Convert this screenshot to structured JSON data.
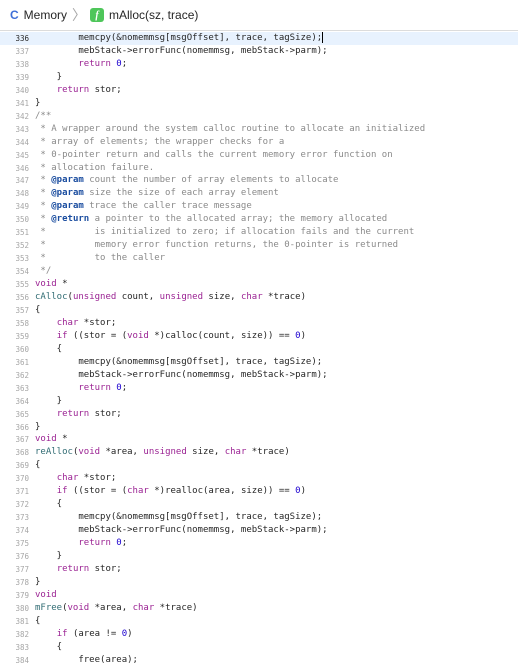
{
  "breadcrumb": {
    "file_icon": "C",
    "file_label": "Memory",
    "separator": "〉",
    "func_icon": "f",
    "func_label": "mAlloc(sz, trace)"
  },
  "colors": {
    "keyword": "#9b2393",
    "number": "#1c00cf",
    "comment": "#8a8a8a",
    "doc_tag": "#1c4ea0",
    "function_name": "#326d74",
    "current_line": "#e8f2fe"
  },
  "editor": {
    "current_line": 336,
    "lines": [
      {
        "n": "336",
        "current": true,
        "caret": true,
        "s": [
          [
            "t",
            "        memcpy(&nomemmsg[msgOffset], trace, tagSize);"
          ]
        ]
      },
      {
        "n": "337",
        "s": [
          [
            "t",
            "        mebStack->errorFunc(nomemmsg, mebStack->parm);"
          ]
        ]
      },
      {
        "n": "338",
        "s": [
          [
            "t",
            "        "
          ],
          [
            "k",
            "return"
          ],
          [
            "t",
            " "
          ],
          [
            "n",
            "0"
          ],
          [
            "t",
            ";"
          ]
        ]
      },
      {
        "n": "339",
        "s": [
          [
            "t",
            "    }"
          ]
        ]
      },
      {
        "n": "340",
        "s": [
          [
            "t",
            "    "
          ],
          [
            "k",
            "return"
          ],
          [
            "t",
            " stor;"
          ]
        ]
      },
      {
        "n": "341",
        "s": [
          [
            "t",
            "}"
          ]
        ]
      },
      {
        "n": "342",
        "s": [
          [
            "c",
            "/**"
          ]
        ]
      },
      {
        "n": "343",
        "s": [
          [
            "c",
            " * A wrapper around the system calloc routine to allocate an initialized"
          ]
        ]
      },
      {
        "n": "344",
        "s": [
          [
            "c",
            " * array of elements; the wrapper checks for a"
          ]
        ]
      },
      {
        "n": "345",
        "s": [
          [
            "c",
            " * 0-pointer return and calls the current memory error function on"
          ]
        ]
      },
      {
        "n": "346",
        "s": [
          [
            "c",
            " * allocation failure."
          ]
        ]
      },
      {
        "n": "347",
        "s": [
          [
            "c",
            " * "
          ],
          [
            "d",
            "@param"
          ],
          [
            "c",
            " count the number of array elements to allocate"
          ]
        ]
      },
      {
        "n": "348",
        "s": [
          [
            "c",
            " * "
          ],
          [
            "d",
            "@param"
          ],
          [
            "c",
            " size the size of each array element"
          ]
        ]
      },
      {
        "n": "349",
        "s": [
          [
            "c",
            " * "
          ],
          [
            "d",
            "@param"
          ],
          [
            "c",
            " trace the caller trace message"
          ]
        ]
      },
      {
        "n": "350",
        "s": [
          [
            "c",
            " * "
          ],
          [
            "d",
            "@return"
          ],
          [
            "c",
            " a pointer to the allocated array; the memory allocated"
          ]
        ]
      },
      {
        "n": "351",
        "s": [
          [
            "c",
            " *         is initialized to zero; if allocation fails and the current"
          ]
        ]
      },
      {
        "n": "352",
        "s": [
          [
            "c",
            " *         memory error function returns, the 0-pointer is returned"
          ]
        ]
      },
      {
        "n": "353",
        "s": [
          [
            "c",
            " *         to the caller"
          ]
        ]
      },
      {
        "n": "354",
        "s": [
          [
            "c",
            " */"
          ]
        ]
      },
      {
        "n": "355",
        "s": [
          [
            "k",
            "void"
          ],
          [
            "t",
            " *"
          ]
        ]
      },
      {
        "n": "356",
        "s": [
          [
            "f",
            "cAlloc"
          ],
          [
            "t",
            "("
          ],
          [
            "k",
            "unsigned"
          ],
          [
            "t",
            " count, "
          ],
          [
            "k",
            "unsigned"
          ],
          [
            "t",
            " size, "
          ],
          [
            "k",
            "char"
          ],
          [
            "t",
            " *trace)"
          ]
        ]
      },
      {
        "n": "357",
        "s": [
          [
            "t",
            "{"
          ]
        ]
      },
      {
        "n": "358",
        "s": [
          [
            "t",
            "    "
          ],
          [
            "k",
            "char"
          ],
          [
            "t",
            " *stor;"
          ]
        ]
      },
      {
        "n": "359",
        "s": [
          [
            "t",
            "    "
          ],
          [
            "k",
            "if"
          ],
          [
            "t",
            " ((stor = ("
          ],
          [
            "k",
            "void"
          ],
          [
            "t",
            " *)calloc(count, size)) == "
          ],
          [
            "n",
            "0"
          ],
          [
            "t",
            ")"
          ]
        ]
      },
      {
        "n": "360",
        "s": [
          [
            "t",
            "    {"
          ]
        ]
      },
      {
        "n": "361",
        "s": [
          [
            "t",
            "        memcpy(&nomemmsg[msgOffset], trace, tagSize);"
          ]
        ]
      },
      {
        "n": "362",
        "s": [
          [
            "t",
            "        mebStack->errorFunc(nomemmsg, mebStack->parm);"
          ]
        ]
      },
      {
        "n": "363",
        "s": [
          [
            "t",
            "        "
          ],
          [
            "k",
            "return"
          ],
          [
            "t",
            " "
          ],
          [
            "n",
            "0"
          ],
          [
            "t",
            ";"
          ]
        ]
      },
      {
        "n": "364",
        "s": [
          [
            "t",
            "    }"
          ]
        ]
      },
      {
        "n": "365",
        "s": [
          [
            "t",
            "    "
          ],
          [
            "k",
            "return"
          ],
          [
            "t",
            " stor;"
          ]
        ]
      },
      {
        "n": "366",
        "s": [
          [
            "t",
            "}"
          ]
        ]
      },
      {
        "n": "367",
        "s": [
          [
            "k",
            "void"
          ],
          [
            "t",
            " *"
          ]
        ]
      },
      {
        "n": "368",
        "s": [
          [
            "f",
            "reAlloc"
          ],
          [
            "t",
            "("
          ],
          [
            "k",
            "void"
          ],
          [
            "t",
            " *area, "
          ],
          [
            "k",
            "unsigned"
          ],
          [
            "t",
            " size, "
          ],
          [
            "k",
            "char"
          ],
          [
            "t",
            " *trace)"
          ]
        ]
      },
      {
        "n": "369",
        "s": [
          [
            "t",
            "{"
          ]
        ]
      },
      {
        "n": "370",
        "s": [
          [
            "t",
            "    "
          ],
          [
            "k",
            "char"
          ],
          [
            "t",
            " *stor;"
          ]
        ]
      },
      {
        "n": "371",
        "s": [
          [
            "t",
            "    "
          ],
          [
            "k",
            "if"
          ],
          [
            "t",
            " ((stor = ("
          ],
          [
            "k",
            "char"
          ],
          [
            "t",
            " *)realloc(area, size)) == "
          ],
          [
            "n",
            "0"
          ],
          [
            "t",
            ")"
          ]
        ]
      },
      {
        "n": "372",
        "s": [
          [
            "t",
            "    {"
          ]
        ]
      },
      {
        "n": "373",
        "s": [
          [
            "t",
            "        memcpy(&nomemmsg[msgOffset], trace, tagSize);"
          ]
        ]
      },
      {
        "n": "374",
        "s": [
          [
            "t",
            "        mebStack->errorFunc(nomemmsg, mebStack->parm);"
          ]
        ]
      },
      {
        "n": "375",
        "s": [
          [
            "t",
            "        "
          ],
          [
            "k",
            "return"
          ],
          [
            "t",
            " "
          ],
          [
            "n",
            "0"
          ],
          [
            "t",
            ";"
          ]
        ]
      },
      {
        "n": "376",
        "s": [
          [
            "t",
            "    }"
          ]
        ]
      },
      {
        "n": "377",
        "s": [
          [
            "t",
            "    "
          ],
          [
            "k",
            "return"
          ],
          [
            "t",
            " stor;"
          ]
        ]
      },
      {
        "n": "378",
        "s": [
          [
            "t",
            "}"
          ]
        ]
      },
      {
        "n": "379",
        "s": [
          [
            "k",
            "void"
          ]
        ]
      },
      {
        "n": "380",
        "s": [
          [
            "f",
            "mFree"
          ],
          [
            "t",
            "("
          ],
          [
            "k",
            "void"
          ],
          [
            "t",
            " *area, "
          ],
          [
            "k",
            "char"
          ],
          [
            "t",
            " *trace)"
          ]
        ]
      },
      {
        "n": "381",
        "s": [
          [
            "t",
            "{"
          ]
        ]
      },
      {
        "n": "382",
        "s": [
          [
            "t",
            "    "
          ],
          [
            "k",
            "if"
          ],
          [
            "t",
            " (area != "
          ],
          [
            "n",
            "0"
          ],
          [
            "t",
            ")"
          ]
        ]
      },
      {
        "n": "383",
        "s": [
          [
            "t",
            "    {"
          ]
        ]
      },
      {
        "n": "384",
        "s": [
          [
            "t",
            "        free(area);"
          ]
        ]
      }
    ]
  }
}
